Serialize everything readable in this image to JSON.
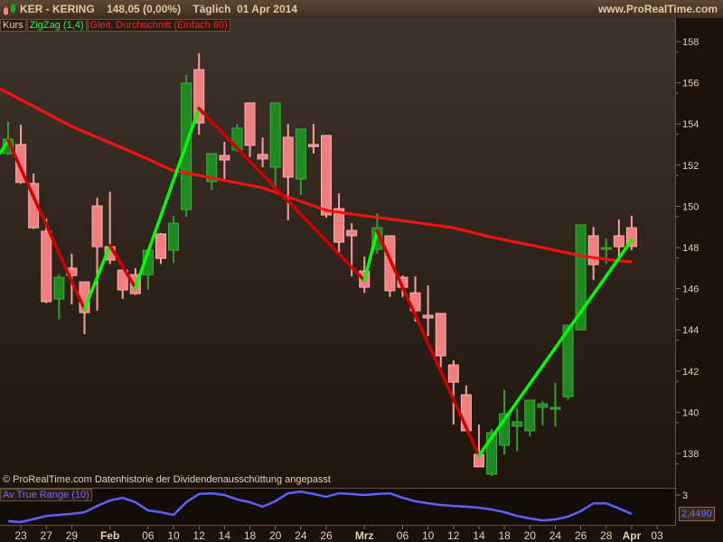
{
  "header": {
    "title": "KER - KERING    148,05 (0,00%)    Täglich  01 Apr 2014",
    "site": "www.ProRealTime.com"
  },
  "legend": {
    "kurs": "Kurs",
    "zigzag": "ZigZag (1,4)",
    "ma": "Gleit. Durchschnitt (Einfach 60)"
  },
  "footnote": "© ProRealTime.com  Datenhistorie der Dividendenausschüttung angepasst",
  "atr": {
    "label": "Av True Range (10)",
    "value": "2,4490",
    "axis_label": "3"
  },
  "colors": {
    "up": "#1f8a1f",
    "down": "#f08080",
    "ma": "#ff1010",
    "zig_up": "#00ff00",
    "zig_down": "#d00000",
    "atr": "#6060ff"
  },
  "chart_data": {
    "type": "candlestick",
    "ylim": [
      136.5,
      159.2
    ],
    "yticks": [
      "138",
      "140",
      "142",
      "144",
      "146",
      "148",
      "150",
      "152",
      "154",
      "156",
      "158"
    ],
    "xticks": [
      {
        "i": 1,
        "label": "23"
      },
      {
        "i": 3,
        "label": "27"
      },
      {
        "i": 5,
        "label": "29"
      },
      {
        "i": 8,
        "label": "Feb",
        "bold": true
      },
      {
        "i": 11,
        "label": "06"
      },
      {
        "i": 13,
        "label": "10"
      },
      {
        "i": 15,
        "label": "12"
      },
      {
        "i": 17,
        "label": "14"
      },
      {
        "i": 19,
        "label": "18"
      },
      {
        "i": 21,
        "label": "20"
      },
      {
        "i": 23,
        "label": "24"
      },
      {
        "i": 25,
        "label": "26"
      },
      {
        "i": 28,
        "label": "Mrz",
        "bold": true
      },
      {
        "i": 31,
        "label": "06"
      },
      {
        "i": 33,
        "label": "10"
      },
      {
        "i": 35,
        "label": "12"
      },
      {
        "i": 37,
        "label": "14"
      },
      {
        "i": 39,
        "label": "18"
      },
      {
        "i": 41,
        "label": "20"
      },
      {
        "i": 43,
        "label": "24"
      },
      {
        "i": 45,
        "label": "26"
      },
      {
        "i": 47,
        "label": "28"
      },
      {
        "i": 49,
        "label": "Apr",
        "bold": true
      },
      {
        "i": 51,
        "label": "03"
      }
    ],
    "ohlc": [
      [
        152.56,
        154.1,
        152.5,
        153.26
      ],
      [
        153.0,
        153.96,
        151.1,
        151.16
      ],
      [
        151.11,
        151.6,
        148.9,
        148.96
      ],
      [
        148.79,
        149.4,
        145.3,
        145.37
      ],
      [
        145.5,
        146.7,
        144.5,
        146.55
      ],
      [
        147.0,
        147.7,
        145.24,
        146.64
      ],
      [
        146.33,
        146.33,
        143.79,
        144.84
      ],
      [
        150.02,
        150.41,
        144.93,
        148.04
      ],
      [
        148.04,
        150.7,
        147.2,
        147.39
      ],
      [
        146.9,
        146.9,
        145.5,
        145.94
      ],
      [
        146.68,
        147.0,
        145.7,
        145.76
      ],
      [
        146.68,
        147.87,
        145.94,
        147.87
      ],
      [
        148.66,
        148.7,
        147.2,
        147.47
      ],
      [
        147.87,
        149.54,
        147.25,
        149.18
      ],
      [
        149.84,
        156.38,
        149.49,
        155.98
      ],
      [
        156.64,
        157.43,
        153.48,
        154.05
      ],
      [
        151.2,
        152.56,
        150.8,
        152.56
      ],
      [
        152.47,
        153.13,
        151.33,
        152.25
      ],
      [
        152.74,
        154.0,
        152.65,
        153.79
      ],
      [
        155.02,
        155.02,
        152.39,
        152.96
      ],
      [
        152.52,
        153.35,
        151.9,
        152.3
      ],
      [
        151.9,
        155.02,
        150.8,
        155.02
      ],
      [
        153.35,
        154.0,
        149.32,
        151.42
      ],
      [
        151.33,
        153.75,
        150.54,
        153.75
      ],
      [
        153.0,
        154.0,
        152.56,
        152.9
      ],
      [
        153.44,
        153.44,
        149.45,
        149.58
      ],
      [
        149.89,
        150.63,
        147.74,
        148.26
      ],
      [
        148.83,
        149.18,
        146.6,
        148.57
      ],
      [
        146.86,
        147.56,
        145.8,
        146.07
      ],
      [
        147.91,
        149.67,
        147.7,
        148.96
      ],
      [
        148.57,
        148.57,
        145.6,
        145.9
      ],
      [
        146.55,
        146.64,
        145.6,
        146.07
      ],
      [
        145.8,
        146.6,
        144.4,
        144.93
      ],
      [
        144.71,
        146.16,
        143.7,
        144.58
      ],
      [
        144.8,
        144.8,
        142.17,
        142.74
      ],
      [
        142.3,
        142.52,
        139.4,
        141.46
      ],
      [
        140.85,
        141.3,
        139.1,
        139.1
      ],
      [
        137.96,
        139.4,
        137.35,
        137.35
      ],
      [
        136.99,
        139.19,
        136.9,
        139.01
      ],
      [
        138.4,
        141.1,
        137.96,
        139.93
      ],
      [
        139.32,
        140.2,
        138.1,
        139.54
      ],
      [
        139.1,
        140.59,
        138.83,
        140.59
      ],
      [
        140.24,
        140.54,
        139.36,
        140.41
      ],
      [
        140.15,
        141.42,
        139.32,
        140.24
      ],
      [
        140.76,
        144.23,
        140.6,
        144.23
      ],
      [
        144.0,
        149.1,
        144.0,
        149.1
      ],
      [
        148.57,
        149.0,
        146.42,
        147.17
      ],
      [
        147.95,
        148.44,
        147.2,
        148.0
      ],
      [
        148.57,
        149.36,
        147.52,
        148.04
      ],
      [
        148.96,
        149.54,
        147.87,
        148.05
      ]
    ],
    "ma60": [
      [
        -1,
        155.8
      ],
      [
        0,
        155.5
      ],
      [
        5,
        153.88
      ],
      [
        10,
        152.56
      ],
      [
        13,
        151.73
      ],
      [
        15,
        151.5
      ],
      [
        20,
        150.9
      ],
      [
        25,
        149.8
      ],
      [
        28,
        149.54
      ],
      [
        31,
        149.3
      ],
      [
        35,
        148.96
      ],
      [
        38,
        148.5
      ],
      [
        42,
        148.0
      ],
      [
        45,
        147.6
      ],
      [
        47,
        147.43
      ],
      [
        49,
        147.3
      ]
    ],
    "zigzag": [
      [
        -0.6,
        152.6
      ],
      [
        0,
        153.2
      ],
      [
        6,
        145.0
      ],
      [
        8,
        148.1
      ],
      [
        10,
        146.05
      ],
      [
        15,
        154.75
      ],
      [
        28,
        146.4
      ],
      [
        29,
        148.8
      ],
      [
        37,
        137.9
      ],
      [
        49,
        148.35
      ]
    ],
    "atr_ylim": [
      2.1,
      3.2
    ],
    "atr_series": [
      2.24,
      2.21,
      2.3,
      2.39,
      2.42,
      2.45,
      2.5,
      2.68,
      2.84,
      2.92,
      2.79,
      2.55,
      2.5,
      2.42,
      2.79,
      3.03,
      3.05,
      3.0,
      2.87,
      2.79,
      2.66,
      2.82,
      3.05,
      3.1,
      3.03,
      2.95,
      3.05,
      3.03,
      3.0,
      3.03,
      3.05,
      2.92,
      2.82,
      2.76,
      2.71,
      2.68,
      2.66,
      2.63,
      2.58,
      2.5,
      2.39,
      2.32,
      2.26,
      2.29,
      2.37,
      2.53,
      2.76,
      2.76,
      2.61,
      2.449
    ]
  }
}
